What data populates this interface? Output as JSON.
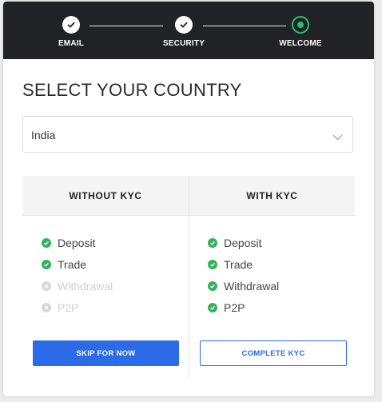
{
  "steps": [
    {
      "label": "EMAIL",
      "state": "done"
    },
    {
      "label": "SECURITY",
      "state": "done"
    },
    {
      "label": "WELCOME",
      "state": "current"
    }
  ],
  "title": "SELECT YOUR COUNTRY",
  "country_select": {
    "value": "India",
    "icon": "chevron-down-icon"
  },
  "without_kyc": {
    "heading": "WITHOUT KYC",
    "features": [
      {
        "label": "Deposit",
        "enabled": true
      },
      {
        "label": "Trade",
        "enabled": true
      },
      {
        "label": "Withdrawal",
        "enabled": false
      },
      {
        "label": "P2P",
        "enabled": false
      }
    ],
    "button": "SKIP FOR NOW"
  },
  "with_kyc": {
    "heading": "WITH KYC",
    "features": [
      {
        "label": "Deposit",
        "enabled": true
      },
      {
        "label": "Trade",
        "enabled": true
      },
      {
        "label": "Withdrawal",
        "enabled": true
      },
      {
        "label": "P2P",
        "enabled": true
      }
    ],
    "button": "COMPLETE KYC"
  },
  "colors": {
    "header_bg": "#212226",
    "accent_green": "#27c06b",
    "check_green": "#34b25a",
    "primary_blue": "#2b6be8"
  }
}
